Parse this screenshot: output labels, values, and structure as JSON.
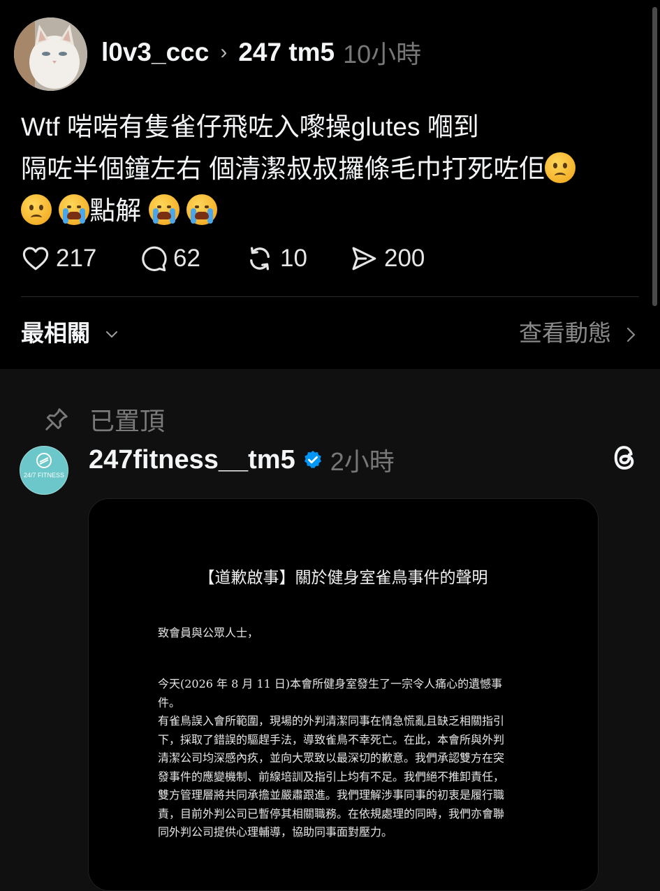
{
  "post": {
    "username": "l0v3_ccc",
    "separator": "›",
    "community": "247 tm5",
    "time": "10小時",
    "text_line1": "Wtf 啱啱有隻雀仔飛咗入嚟操glutes 嗰到",
    "text_line2": "隔咗半個鐘左右 個清潔叔叔攞條毛巾打死咗佢",
    "text_line3_word": "點解",
    "emojis": [
      "worried-face",
      "worried-face",
      "loudly-crying-face",
      "loudly-crying-face",
      "loudly-crying-face"
    ],
    "likes": "217",
    "comments": "62",
    "reposts": "10",
    "shares": "200"
  },
  "sort": {
    "label": "最相關",
    "view_activity": "查看動態"
  },
  "reply": {
    "pinned_label": "已置頂",
    "username": "247fitness__tm5",
    "verified": true,
    "time": "2小時",
    "avatar_text": "24/7 FITNESS",
    "document": {
      "title": "【道歉啟事】關於健身室雀鳥事件的聲明",
      "greeting": "致會員與公眾人士，",
      "lines": [
        "今天(2026 年 8 月 11 日)本會所健身室發生了一宗令人痛心的遺憾事件。",
        "有雀鳥誤入會所範圍，現場的外判清潔同事在情急慌亂且缺乏相關指引",
        "下，採取了錯誤的驅趕手法，導致雀鳥不幸死亡。在此，本會所與外判",
        "清潔公司均深感內疚，並向大眾致以最深切的歉意。我們承認雙方在突",
        "發事件的應變機制、前線培訓及指引上均有不足。我們絕不推卸責任，",
        "雙方管理層將共同承擔並嚴肅跟進。我們理解涉事同事的初衷是履行職",
        "責，目前外判公司已暫停其相關職務。在依規處理的同時，我們亦會聯",
        "同外判公司提供心理輔導，協助同事面對壓力。"
      ]
    }
  },
  "colors": {
    "background": "#101010",
    "post_background": "#000000",
    "text": "#f3f5f7",
    "muted": "#777777",
    "verified_blue": "#0095f6",
    "avatar_teal": "#6bc7c9"
  }
}
